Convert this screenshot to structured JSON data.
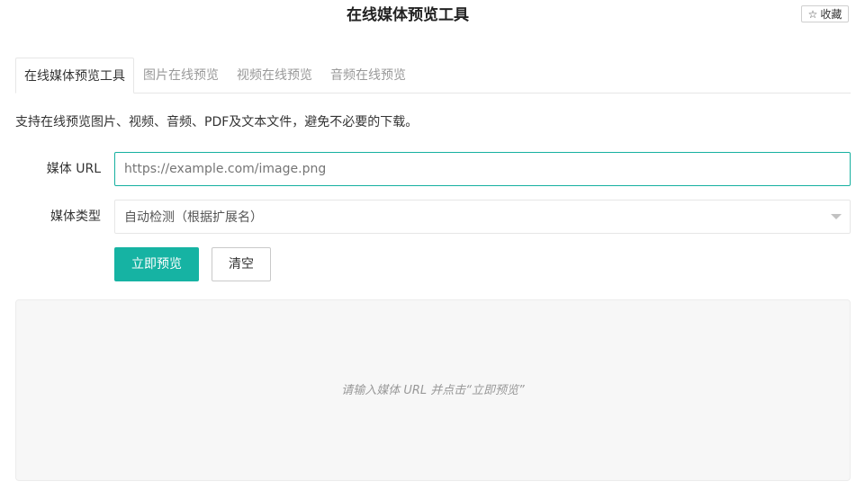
{
  "header": {
    "title": "在线媒体预览工具",
    "favorite": {
      "icon": "star-outline-icon",
      "label": "收藏"
    }
  },
  "tabs": [
    {
      "label": "在线媒体预览工具",
      "active": true
    },
    {
      "label": "图片在线预览",
      "active": false
    },
    {
      "label": "视频在线预览",
      "active": false
    },
    {
      "label": "音频在线预览",
      "active": false
    }
  ],
  "description": "支持在线预览图片、视频、音频、PDF及文本文件，避免不必要的下载。",
  "form": {
    "url": {
      "label": "媒体 URL",
      "value": "",
      "placeholder": "https://example.com/image.png"
    },
    "type": {
      "label": "媒体类型",
      "selected": "自动检测（根据扩展名）"
    },
    "preview_button": "立即预览",
    "clear_button": "清空"
  },
  "preview": {
    "hint": "请输入媒体 URL 并点击“立即预览”"
  },
  "colors": {
    "accent": "#16b3a3",
    "input_focus_border": "#16b0a0",
    "preview_background": "#f7f7f7"
  }
}
